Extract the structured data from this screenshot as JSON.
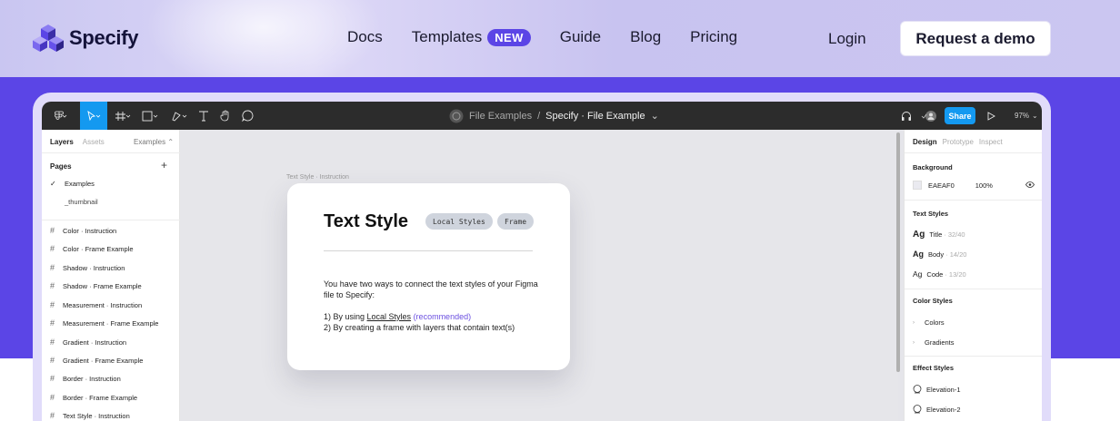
{
  "header": {
    "logo_text": "Specify",
    "nav": [
      {
        "label": "Docs"
      },
      {
        "label": "Templates",
        "badge": "NEW"
      },
      {
        "label": "Guide"
      },
      {
        "label": "Blog"
      },
      {
        "label": "Pricing"
      }
    ],
    "login_label": "Login",
    "demo_label": "Request a demo"
  },
  "toolbar": {
    "file_location": "File Examples",
    "separator": "/",
    "file_name": "Specify · File Example",
    "share_label": "Share",
    "zoom": "97%"
  },
  "left_panel": {
    "tabs": {
      "layers": "Layers",
      "assets": "Assets"
    },
    "page_selector": "Examples",
    "pages_label": "Pages",
    "pages": [
      {
        "label": "Examples",
        "current": true
      },
      {
        "label": "_thumbnail",
        "current": false
      }
    ],
    "layers": [
      "Color · Instruction",
      "Color · Frame Example",
      "Shadow · Instruction",
      "Shadow · Frame Example",
      "Measurement · Instruction",
      "Measurement · Frame Example",
      "Gradient · Instruction",
      "Gradient · Frame Example",
      "Border · Instruction",
      "Border · Frame Example",
      "Text Style · Instruction"
    ]
  },
  "canvas": {
    "frame_label": "Text Style · Instruction",
    "card": {
      "title": "Text Style",
      "chips": [
        "Local Styles",
        "Frame"
      ],
      "para1": "You have two ways to connect the text styles of your Figma file to Specify:",
      "item1_prefix": "1) By using ",
      "item1_link": "Local Styles",
      "item1_suffix": " (recommended)",
      "item2": "2) By creating a frame with layers that contain text(s)"
    }
  },
  "right_panel": {
    "tabs": {
      "design": "Design",
      "prototype": "Prototype",
      "inspect": "Inspect"
    },
    "background_label": "Background",
    "bg_hex": "EAEAF0",
    "bg_opacity": "100%",
    "text_styles_label": "Text Styles",
    "text_styles": [
      {
        "ag": "Ag",
        "name": "Title",
        "size": "· 32/40"
      },
      {
        "ag": "Ag",
        "name": "Body",
        "size": "· 14/20"
      },
      {
        "ag": "Ag",
        "name": "Code",
        "size": "· 13/20"
      }
    ],
    "color_styles_label": "Color Styles",
    "color_styles": [
      "Colors",
      "Gradients"
    ],
    "effect_styles_label": "Effect Styles",
    "effect_styles": [
      "Elevation-1",
      "Elevation-2"
    ]
  },
  "colors": {
    "brand": "#5b45e6",
    "figma_blue": "#1499f0",
    "toolbar_bg": "#2c2c2c"
  }
}
